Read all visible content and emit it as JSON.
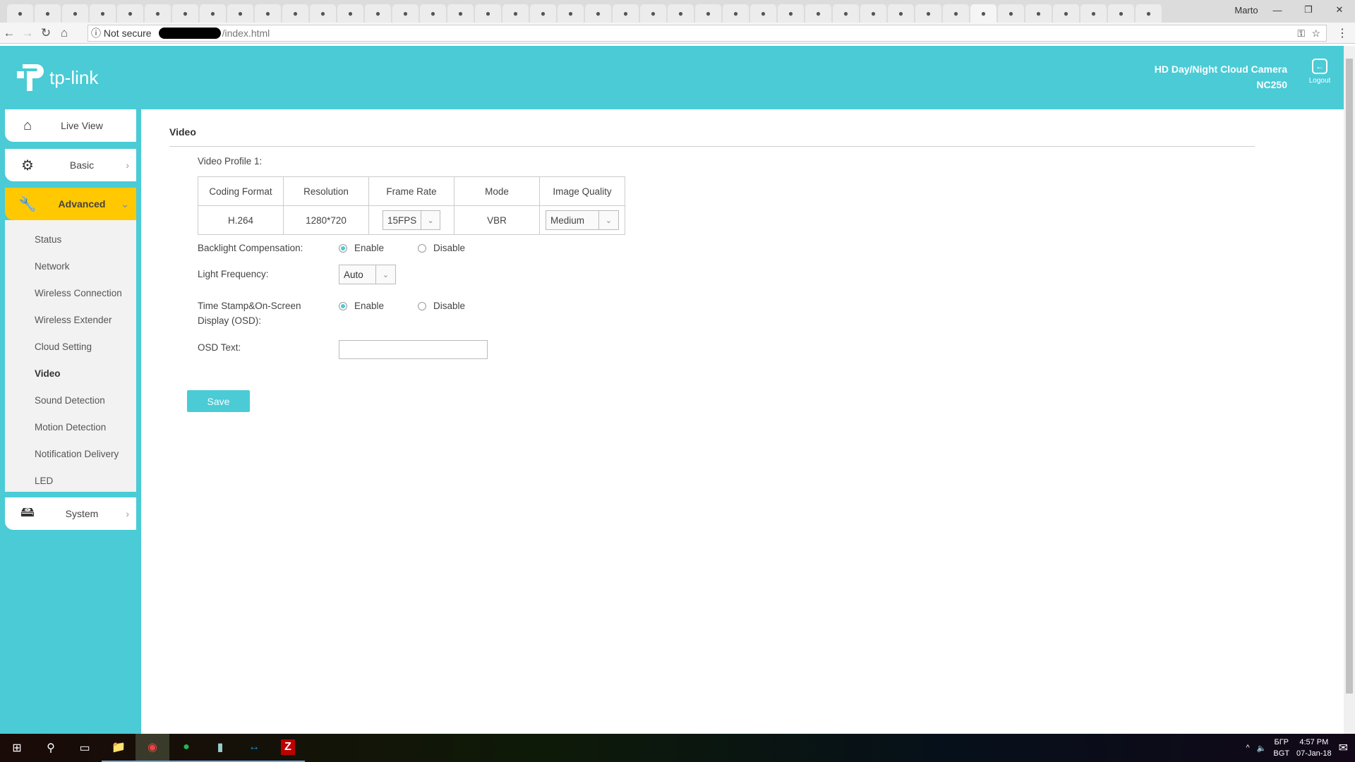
{
  "browser": {
    "tab_count": 42,
    "user": "Marto",
    "address_security": "Not secure",
    "address_path": "/index.html"
  },
  "header": {
    "brand": "tp-link",
    "product": "HD Day/Night Cloud Camera",
    "model": "NC250",
    "logout": "Logout"
  },
  "sidebar": {
    "items": [
      {
        "label": "Live View"
      },
      {
        "label": "Basic"
      },
      {
        "label": "Advanced"
      },
      {
        "label": "System"
      }
    ],
    "submenu": [
      "Status",
      "Network",
      "Wireless Connection",
      "Wireless Extender",
      "Cloud Setting",
      "Video",
      "Sound Detection",
      "Motion Detection",
      "Notification Delivery",
      "LED"
    ]
  },
  "page": {
    "title": "Video",
    "profile_label": "Video Profile 1:",
    "table": {
      "headers": [
        "Coding Format",
        "Resolution",
        "Frame Rate",
        "Mode",
        "Image Quality"
      ],
      "row": {
        "coding": "H.264",
        "resolution": "1280*720",
        "frame_rate": "15FPS",
        "mode": "VBR",
        "quality": "Medium"
      }
    },
    "backlight_label": "Backlight Compensation:",
    "enable": "Enable",
    "disable": "Disable",
    "backlight_value": "Enable",
    "light_freq_label": "Light Frequency:",
    "light_freq_value": "Auto",
    "osd_label": "Time Stamp&On-Screen Display (OSD):",
    "osd_value": "Enable",
    "osd_text_label": "OSD Text:",
    "osd_text_value": "",
    "save": "Save"
  },
  "taskbar": {
    "lang": "БГР",
    "lang2": "BGT",
    "time": "4:57 PM",
    "date": "07-Jan-18"
  }
}
